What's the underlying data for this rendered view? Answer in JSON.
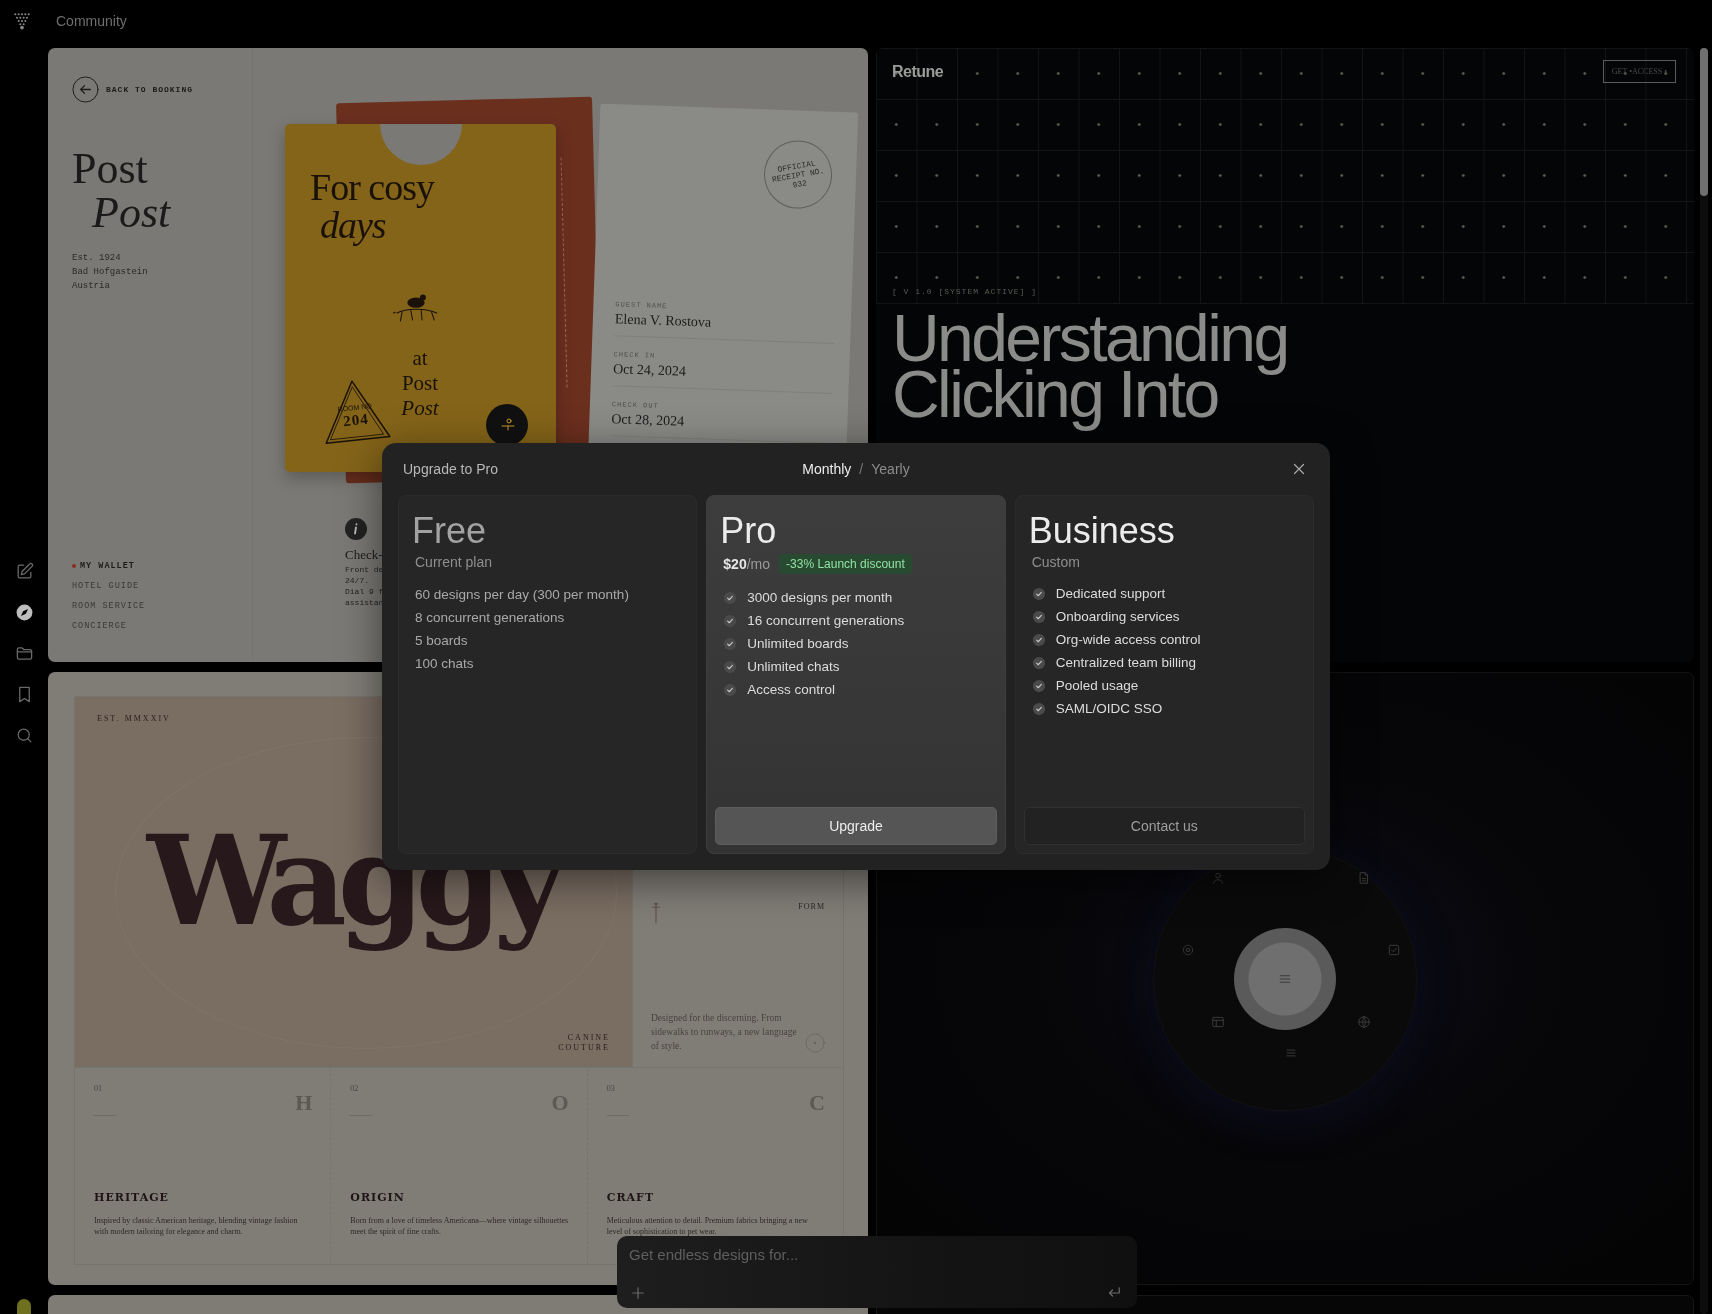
{
  "topbar": {
    "title": "Community"
  },
  "sidebar": {
    "items": [
      {
        "selected": false
      },
      {
        "selected": true
      },
      {
        "selected": false
      },
      {
        "selected": false
      },
      {
        "selected": false
      }
    ]
  },
  "hotel_card": {
    "back_link": "BACK TO BOOKING",
    "brand": [
      "Post",
      "Post"
    ],
    "address": [
      "Est. 1924",
      "Bad Hofgastein",
      "Austria"
    ],
    "nav": [
      {
        "label": "MY WALLET",
        "selected": true
      },
      {
        "label": "HOTEL GUIDE",
        "selected": false
      },
      {
        "label": "ROOM SERVICE",
        "selected": false
      },
      {
        "label": "CONCIERGE",
        "selected": false
      }
    ],
    "hang_tag": {
      "headline": [
        "For cosy",
        "days"
      ],
      "footer": [
        "at",
        "Post",
        "Post"
      ],
      "stamp_label": "ROOM NO",
      "room_number": "204"
    },
    "receipt": {
      "stamp": "OFFICIAL RECEIPT NO. 932",
      "fields": [
        {
          "label": "GUEST NAME",
          "value": "Elena V. Rostova"
        },
        {
          "label": "CHECK IN",
          "value": "Oct 24, 2024"
        },
        {
          "label": "CHECK OUT",
          "value": "Oct 28, 2024"
        }
      ]
    },
    "info": {
      "title": "Check-",
      "lines": [
        "Front de",
        "24/7.",
        "Dial 9 f",
        "assistan"
      ]
    }
  },
  "retune_card": {
    "logo": "Retune",
    "button": "GET •ACCESS •",
    "version": "[ V 1.0 [SYSTEM ACTIVE] ]",
    "headline": [
      "Understanding",
      "Clicking Into"
    ]
  },
  "waggy_card": {
    "est": "EST. MMXXIV",
    "wordmark": "Waggy",
    "tagline": "CANINE COUTURE",
    "panel": {
      "label": "FORM",
      "text": "Designed for the discerning. From sidewalks to runways, a new language of style."
    },
    "columns": [
      {
        "number": "01",
        "letter": "H",
        "title": "HERITAGE",
        "text": "Inspired by classic American heritage, blending vintage fashion with modern tailoring for elegance and charm."
      },
      {
        "number": "02",
        "letter": "O",
        "title": "ORIGIN",
        "text": "Born from a love of timeless Americana—where vintage silhouettes meet the spirit of fine crafts."
      },
      {
        "number": "03",
        "letter": "C",
        "title": "CRAFT",
        "text": "Meticulous attention to detail. Premium fabrics bringing a new level of sophistication to pet wear."
      }
    ]
  },
  "modal": {
    "title": "Upgrade to Pro",
    "billing": [
      {
        "label": "Monthly",
        "selected": true
      },
      {
        "label": "Yearly",
        "selected": false
      }
    ],
    "separator": "/",
    "plans": [
      {
        "name": "Free",
        "subtitle": "Current plan",
        "current": true,
        "highlighted": false,
        "checkmarks": false,
        "features": [
          "60 designs per day (300 per month)",
          "8 concurrent generations",
          "5 boards",
          "100 chats"
        ]
      },
      {
        "name": "Pro",
        "price": "$20",
        "period": "/mo",
        "badge": "-33% Launch discount",
        "current": false,
        "highlighted": true,
        "checkmarks": true,
        "features": [
          "3000 designs per month",
          "16 concurrent generations",
          "Unlimited boards",
          "Unlimited chats",
          "Access control"
        ],
        "button": {
          "label": "Upgrade",
          "kind": "primary"
        }
      },
      {
        "name": "Business",
        "subtitle": "Custom",
        "current": false,
        "highlighted": false,
        "checkmarks": true,
        "features": [
          "Dedicated support",
          "Onboarding services",
          "Org-wide access control",
          "Centralized team billing",
          "Pooled usage",
          "SAML/OIDC SSO"
        ],
        "button": {
          "label": "Contact us",
          "kind": "outline"
        }
      }
    ]
  },
  "prompt": {
    "placeholder": "Get endless designs for..."
  }
}
